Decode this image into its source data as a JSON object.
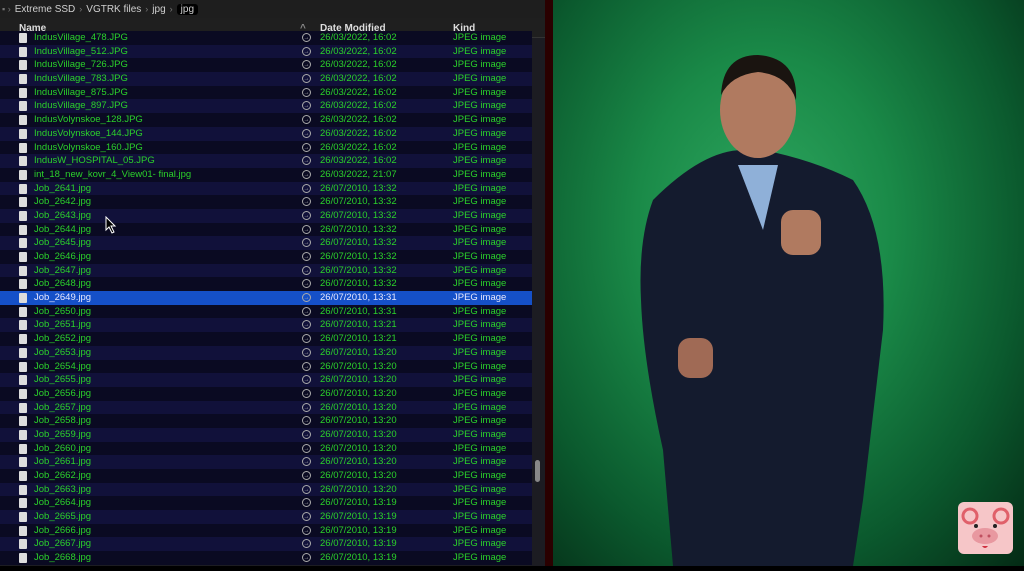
{
  "breadcrumb": [
    "Extreme SSD",
    "VGTRK files",
    "jpg",
    "jpg"
  ],
  "columns": {
    "name": "Name",
    "date": "Date Modified",
    "kind": "Kind"
  },
  "selected_index": 19,
  "files": [
    [
      "IndusVillage_478.JPG",
      "26/03/2022, 16:02"
    ],
    [
      "IndusVillage_512.JPG",
      "26/03/2022, 16:02"
    ],
    [
      "IndusVillage_726.JPG",
      "26/03/2022, 16:02"
    ],
    [
      "IndusVillage_783.JPG",
      "26/03/2022, 16:02"
    ],
    [
      "IndusVillage_875.JPG",
      "26/03/2022, 16:02"
    ],
    [
      "IndusVillage_897.JPG",
      "26/03/2022, 16:02"
    ],
    [
      "IndusVolynskoe_128.JPG",
      "26/03/2022, 16:02"
    ],
    [
      "IndusVolynskoe_144.JPG",
      "26/03/2022, 16:02"
    ],
    [
      "IndusVolynskoe_160.JPG",
      "26/03/2022, 16:02"
    ],
    [
      "IndusW_HOSPITAL_05.JPG",
      "26/03/2022, 16:02"
    ],
    [
      "int_18_new_kovr_4_View01- final.jpg",
      "26/03/2022, 21:07"
    ],
    [
      "Job_2641.jpg",
      "26/07/2010, 13:32"
    ],
    [
      "Job_2642.jpg",
      "26/07/2010, 13:32"
    ],
    [
      "Job_2643.jpg",
      "26/07/2010, 13:32"
    ],
    [
      "Job_2644.jpg",
      "26/07/2010, 13:32"
    ],
    [
      "Job_2645.jpg",
      "26/07/2010, 13:32"
    ],
    [
      "Job_2646.jpg",
      "26/07/2010, 13:32"
    ],
    [
      "Job_2647.jpg",
      "26/07/2010, 13:32"
    ],
    [
      "Job_2648.jpg",
      "26/07/2010, 13:32"
    ],
    [
      "Job_2649.jpg",
      "26/07/2010, 13:31"
    ],
    [
      "Job_2650.jpg",
      "26/07/2010, 13:31"
    ],
    [
      "Job_2651.jpg",
      "26/07/2010, 13:21"
    ],
    [
      "Job_2652.jpg",
      "26/07/2010, 13:21"
    ],
    [
      "Job_2653.jpg",
      "26/07/2010, 13:20"
    ],
    [
      "Job_2654.jpg",
      "26/07/2010, 13:20"
    ],
    [
      "Job_2655.jpg",
      "26/07/2010, 13:20"
    ],
    [
      "Job_2656.jpg",
      "26/07/2010, 13:20"
    ],
    [
      "Job_2657.jpg",
      "26/07/2010, 13:20"
    ],
    [
      "Job_2658.jpg",
      "26/07/2010, 13:20"
    ],
    [
      "Job_2659.jpg",
      "26/07/2010, 13:20"
    ],
    [
      "Job_2660.jpg",
      "26/07/2010, 13:20"
    ],
    [
      "Job_2661.jpg",
      "26/07/2010, 13:20"
    ],
    [
      "Job_2662.jpg",
      "26/07/2010, 13:20"
    ],
    [
      "Job_2663.jpg",
      "26/07/2010, 13:20"
    ],
    [
      "Job_2664.jpg",
      "26/07/2010, 13:19"
    ],
    [
      "Job_2665.jpg",
      "26/07/2010, 13:19"
    ],
    [
      "Job_2666.jpg",
      "26/07/2010, 13:19"
    ],
    [
      "Job_2667.jpg",
      "26/07/2010, 13:19"
    ],
    [
      "Job_2668.jpg",
      "26/07/2010, 13:19"
    ]
  ],
  "kind_label": "JPEG image",
  "colors": {
    "file_text": "#2bd12b",
    "selection": "#1550c8",
    "backdrop": "#1a8a48"
  }
}
